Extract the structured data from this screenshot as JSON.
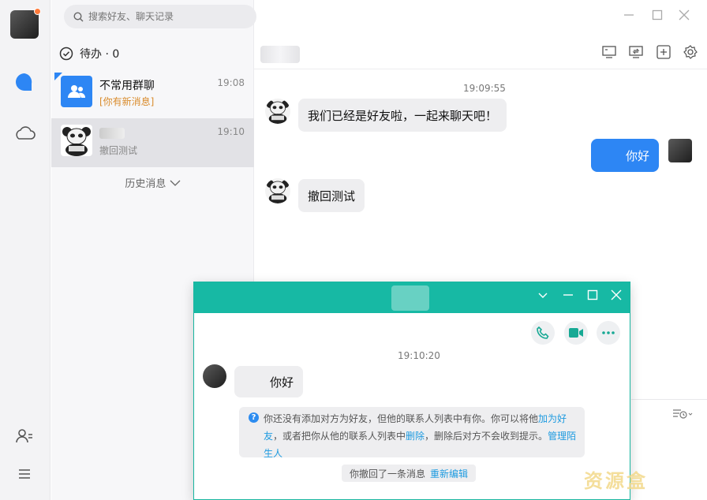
{
  "search": {
    "placeholder": "搜索好友、聊天记录"
  },
  "todo": {
    "label": "待办 · 0"
  },
  "conversations": [
    {
      "name": "不常用群聊",
      "sub": "[你有新消息]",
      "time": "19:08"
    },
    {
      "name": "",
      "sub": "撤回测试",
      "time": "19:10"
    }
  ],
  "history_label": "历史消息",
  "chat": {
    "timestamp": "19:09:55",
    "messages": [
      {
        "text": "我们已经是好友啦，一起来聊天吧！",
        "dir": "in"
      },
      {
        "text": "你好",
        "dir": "out"
      },
      {
        "text": "撤回测试",
        "dir": "in"
      }
    ]
  },
  "popup": {
    "timestamp": "19:10:20",
    "message": "你好",
    "notice": {
      "text1": "你还没有添加对方为好友，但他的联系人列表中有你。你可以将他",
      "link_add": "加为好友",
      "text2": "，或者把你从他的联系人列表中",
      "link_delete": "删除",
      "text3": "，删除后对方不会收到提示。",
      "link_manage": "管理陌生人"
    },
    "recall_text": "你撤回了一条消息",
    "recall_link": "重新编辑"
  },
  "watermark": "资源盒",
  "colors": {
    "accent_blue": "#2d86f4",
    "popup_teal": "#17b9a4"
  }
}
